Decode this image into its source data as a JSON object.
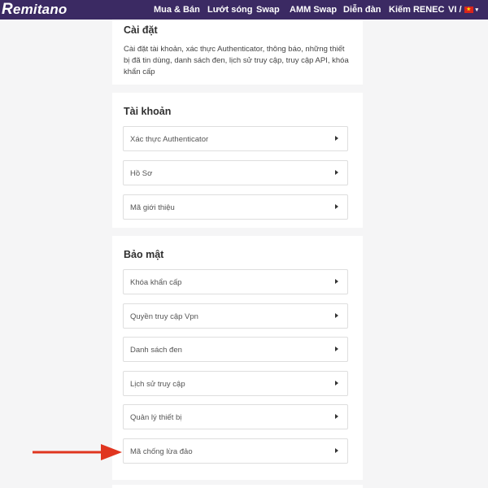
{
  "brand": {
    "logo_text": "emitano",
    "logo_mark": "R"
  },
  "nav": {
    "items": [
      "Mua & Bán",
      "Lướt sóng",
      "Swap",
      "AMM Swap",
      "Diễn đàn",
      "Kiếm RENEC"
    ],
    "language": "VI /"
  },
  "settings": {
    "title": "Cài đặt",
    "description": "Cài đặt tài khoản, xác thực Authenticator, thông báo, những thiết bị đã tin dùng, danh sách đen, lịch sử truy cập, truy cập API, khóa khẩn cấp"
  },
  "account": {
    "title": "Tài khoản",
    "items": [
      "Xác thực Authenticator",
      "Hồ Sơ",
      "Mã giới thiệu"
    ]
  },
  "security": {
    "title": "Bảo mật",
    "items": [
      "Khóa khẩn cấp",
      "Quyền truy cập Vpn",
      "Danh sách đen",
      "Lịch sử truy cập",
      "Quản lý thiết bị",
      "Mã chống lừa đảo"
    ]
  },
  "colors": {
    "nav_bg": "#3b2a63",
    "page_bg": "#f5f5f6",
    "annotation_arrow": "#e0351f"
  },
  "icons": {
    "flag": "vietnam-flag-icon",
    "row_arrow": "caret-right-icon",
    "annotation": "annotation-arrow-icon"
  }
}
